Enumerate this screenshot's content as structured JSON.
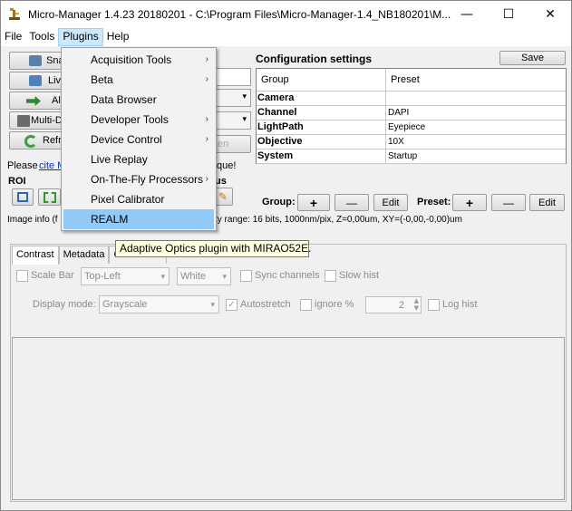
{
  "window": {
    "title": "Micro-Manager 1.4.23 20180201 - C:\\Program Files\\Micro-Manager-1.4_NB180201\\M...",
    "minimize": "—",
    "maximize": "☐",
    "close": "✕"
  },
  "menubar": [
    "File",
    "Tools",
    "Plugins",
    "Help"
  ],
  "left_buttons": [
    "Sna",
    "Liv",
    "Al",
    "Multi-D",
    "Refr"
  ],
  "please_text": "Please ",
  "cite_text": "cite M",
  "roi_label": "ROI",
  "image_info": "Image info (f",
  "range_info": "ty range: 16 bits, 1000nm/pix, Z=0,00um, XY=(-0,00,-0,00)um",
  "hidden_partial": {
    "que": "que!",
    "us": "us",
    "en": "en"
  },
  "config": {
    "title": "Configuration settings",
    "save": "Save",
    "col_group": "Group",
    "col_preset": "Preset",
    "rows": [
      {
        "group": "Camera",
        "preset": ""
      },
      {
        "group": "Channel",
        "preset": "DAPI"
      },
      {
        "group": "LightPath",
        "preset": "Eyepiece"
      },
      {
        "group": "Objective",
        "preset": "10X"
      },
      {
        "group": "System",
        "preset": "Startup"
      }
    ],
    "group_label": "Group:",
    "preset_label": "Preset:",
    "plus": "+",
    "minus": "—",
    "edit": "Edit"
  },
  "plugins_menu": [
    {
      "label": "Acquisition Tools",
      "submenu": true
    },
    {
      "label": "Beta",
      "submenu": true
    },
    {
      "label": "Data Browser",
      "submenu": false
    },
    {
      "label": "Developer Tools",
      "submenu": true
    },
    {
      "label": "Device Control",
      "submenu": true
    },
    {
      "label": "Live Replay",
      "submenu": false
    },
    {
      "label": "On-The-Fly Processors",
      "submenu": true
    },
    {
      "label": "Pixel Calibrator",
      "submenu": false
    },
    {
      "label": "REALM",
      "submenu": false,
      "highlighted": true
    }
  ],
  "tooltip": "Adaptive Optics plugin with MIRAO52E.",
  "tabs": [
    "Contrast",
    "Metadata",
    "Comments"
  ],
  "contrast": {
    "scale_bar": "Scale Bar",
    "position": "Top-Left",
    "color": "White",
    "sync_channels": "Sync channels",
    "slow_hist": "Slow hist",
    "display_mode_label": "Display mode:",
    "display_mode": "Grayscale",
    "autostretch": "Autostretch",
    "ignore": "ignore %",
    "ignore_value": "2",
    "log_hist": "Log hist"
  }
}
